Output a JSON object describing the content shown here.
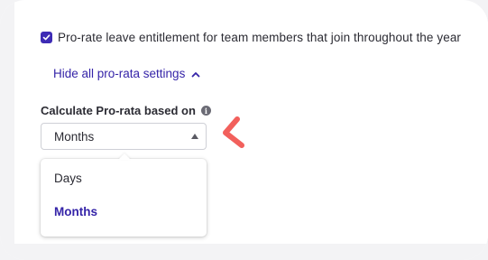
{
  "settings": {
    "prorate_checkbox": {
      "checked": true,
      "label": "Pro-rate leave entitlement for team members that join throughout the year"
    },
    "toggle_link": {
      "label": "Hide all pro-rata settings",
      "icon": "chevron-up-icon"
    },
    "calculate_field": {
      "label": "Calculate Pro-rata based on",
      "info_icon": "info-icon",
      "selected_value": "Months",
      "options": [
        {
          "label": "Days",
          "selected": false
        },
        {
          "label": "Months",
          "selected": true
        }
      ]
    }
  },
  "colors": {
    "accent": "#3d2bb5",
    "link": "#3524a8",
    "annotation": "#f2605c",
    "text": "#2b2b33"
  }
}
